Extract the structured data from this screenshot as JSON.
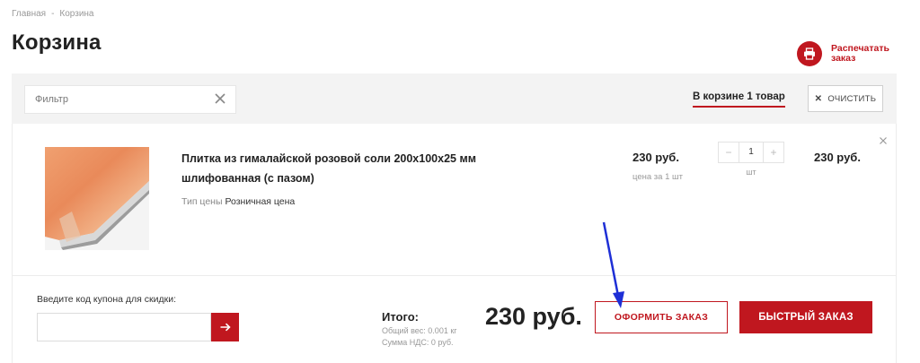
{
  "breadcrumb": {
    "home": "Главная",
    "separator": "-",
    "current": "Корзина"
  },
  "page": {
    "title": "Корзина"
  },
  "print": {
    "label": "Распечатать заказ",
    "icon": "printer-icon"
  },
  "toolbar": {
    "filter_placeholder": "Фильтр",
    "cart_count": "В корзине 1 товар",
    "clear_label": "ОЧИСТИТЬ"
  },
  "cart": {
    "items": [
      {
        "name": "Плитка из гималайской розовой соли 200х100х25 мм шлифованная (с пазом)",
        "price_type_label": "Тип цены",
        "price_type_value": "Розничная цена",
        "unit_price": "230 руб.",
        "unit_price_note": "цена за 1 шт",
        "quantity": "1",
        "unit": "шт",
        "total": "230 руб."
      }
    ]
  },
  "footer": {
    "coupon_label": "Введите код купона для скидки:",
    "total_label": "Итого:",
    "weight": "Общий вес: 0.001 кг",
    "vat": "Сумма НДС: 0 руб.",
    "grand_total": "230 руб.",
    "checkout_label": "ОФОРМИТЬ ЗАКАЗ",
    "quick_order_label": "БЫСТРЫЙ ЗАКАЗ"
  },
  "colors": {
    "accent": "#c0171f",
    "annotation": "#1e2fd6"
  }
}
